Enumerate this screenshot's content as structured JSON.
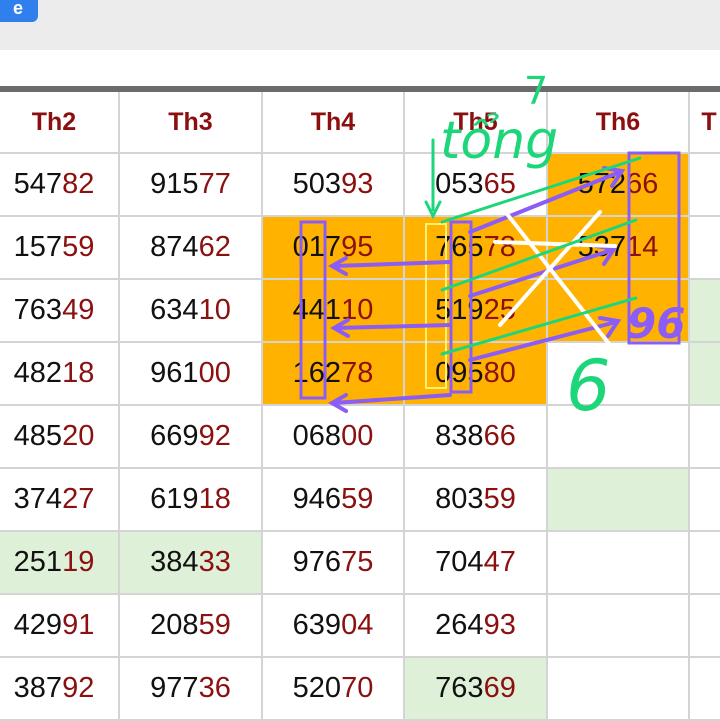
{
  "top_button": {
    "label": "e"
  },
  "table": {
    "headers": [
      "Th2",
      "Th3",
      "Th4",
      "Th5",
      "Th6",
      "T"
    ],
    "rows": [
      [
        {
          "head": "547",
          "tail": "82"
        },
        {
          "head": "915",
          "tail": "77"
        },
        {
          "head": "503",
          "tail": "93"
        },
        {
          "head": "053",
          "tail": "65"
        },
        {
          "head": "572",
          "tail": "66"
        },
        {
          "head": "",
          "tail": ""
        }
      ],
      [
        {
          "head": "157",
          "tail": "59"
        },
        {
          "head": "874",
          "tail": "62"
        },
        {
          "head": "017",
          "tail": "95"
        },
        {
          "head": "765",
          "tail": "78"
        },
        {
          "head": "537",
          "tail": "14"
        },
        {
          "head": "",
          "tail": ""
        }
      ],
      [
        {
          "head": "763",
          "tail": "49"
        },
        {
          "head": "634",
          "tail": "10"
        },
        {
          "head": "441",
          "tail": "10"
        },
        {
          "head": "519",
          "tail": "25"
        },
        {
          "head": "",
          "tail": ""
        },
        {
          "head": "",
          "tail": ""
        }
      ],
      [
        {
          "head": "482",
          "tail": "18"
        },
        {
          "head": "961",
          "tail": "00"
        },
        {
          "head": "162",
          "tail": "78"
        },
        {
          "head": "095",
          "tail": "80"
        },
        {
          "head": "",
          "tail": ""
        },
        {
          "head": "",
          "tail": ""
        }
      ],
      [
        {
          "head": "485",
          "tail": "20"
        },
        {
          "head": "669",
          "tail": "92"
        },
        {
          "head": "068",
          "tail": "00"
        },
        {
          "head": "838",
          "tail": "66"
        },
        {
          "head": "",
          "tail": ""
        },
        {
          "head": "",
          "tail": ""
        }
      ],
      [
        {
          "head": "374",
          "tail": "27"
        },
        {
          "head": "619",
          "tail": "18"
        },
        {
          "head": "946",
          "tail": "59"
        },
        {
          "head": "803",
          "tail": "59"
        },
        {
          "head": "",
          "tail": ""
        },
        {
          "head": "",
          "tail": ""
        }
      ],
      [
        {
          "head": "251",
          "tail": "19"
        },
        {
          "head": "384",
          "tail": "33"
        },
        {
          "head": "976",
          "tail": "75"
        },
        {
          "head": "704",
          "tail": "47"
        },
        {
          "head": "",
          "tail": ""
        },
        {
          "head": "",
          "tail": ""
        }
      ],
      [
        {
          "head": "429",
          "tail": "91"
        },
        {
          "head": "208",
          "tail": "59"
        },
        {
          "head": "639",
          "tail": "04"
        },
        {
          "head": "264",
          "tail": "93"
        },
        {
          "head": "",
          "tail": ""
        },
        {
          "head": "",
          "tail": ""
        }
      ],
      [
        {
          "head": "387",
          "tail": "92"
        },
        {
          "head": "977",
          "tail": "36"
        },
        {
          "head": "520",
          "tail": "70"
        },
        {
          "head": "763",
          "tail": "69"
        },
        {
          "head": "",
          "tail": ""
        },
        {
          "head": "",
          "tail": ""
        }
      ]
    ]
  },
  "annotations": {
    "word": "tổng",
    "extra_mark": "7",
    "handwritten_96": "96",
    "handwritten_6": "6"
  },
  "colors": {
    "highlight": "#ffb300",
    "light_green": "#dff0d8",
    "header_red": "#8b0f0f",
    "tail_red": "#8b1010",
    "ink_purple": "#8b5cf6",
    "ink_green": "#1ed67a",
    "ink_white": "#ffffff"
  }
}
